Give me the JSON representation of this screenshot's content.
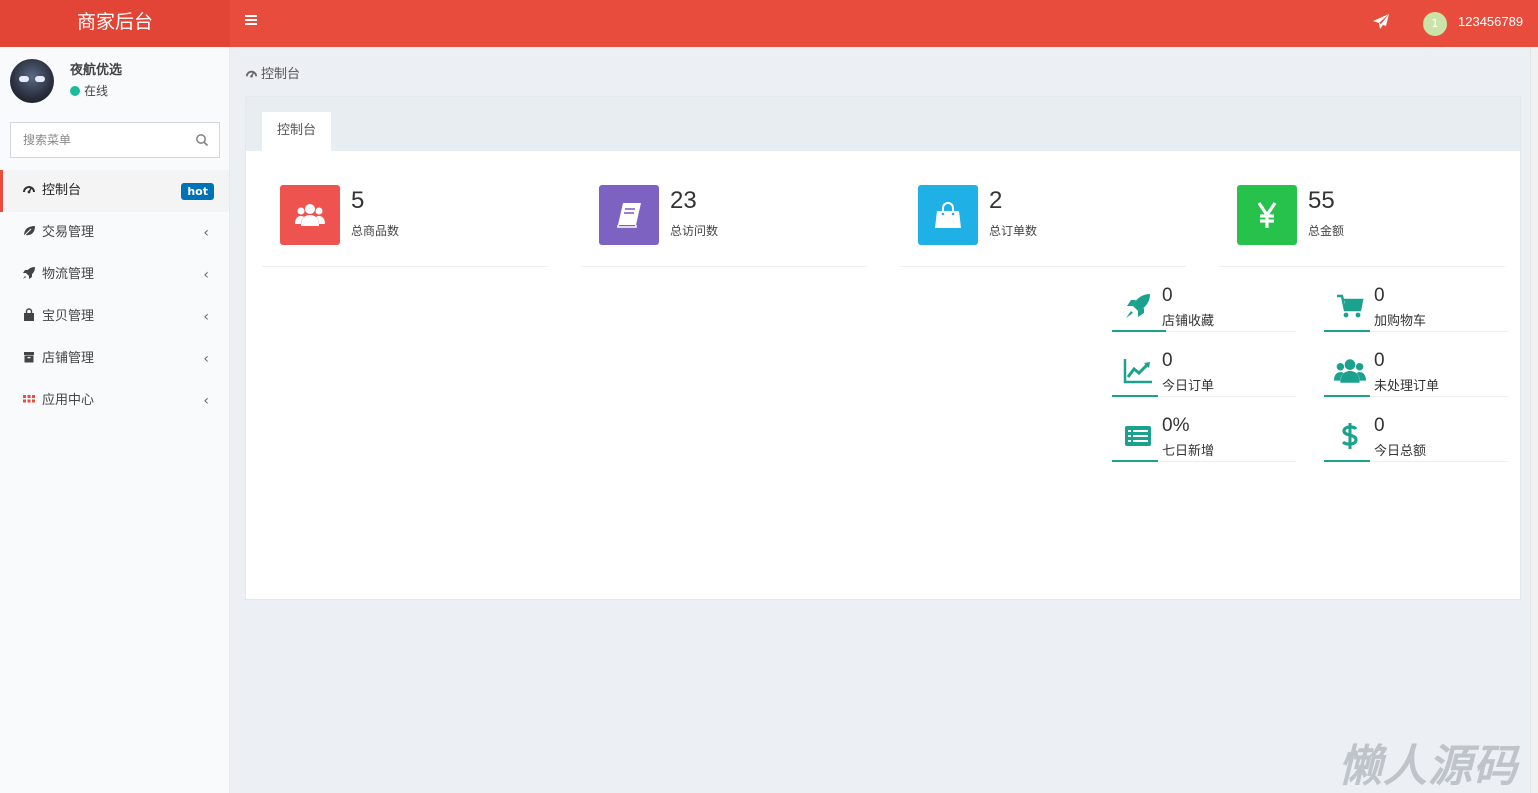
{
  "app": {
    "title": "商家后台",
    "user_id": "123456789",
    "avatar_badge": "1"
  },
  "sidebar": {
    "user_name": "夜航优选",
    "status": "在线",
    "search_placeholder": "搜索菜单",
    "items": [
      {
        "label": "控制台",
        "icon": "dashboard-icon",
        "badge": "hot"
      },
      {
        "label": "交易管理",
        "icon": "leaf-icon"
      },
      {
        "label": "物流管理",
        "icon": "rocket-icon"
      },
      {
        "label": "宝贝管理",
        "icon": "shopping-bag-icon"
      },
      {
        "label": "店铺管理",
        "icon": "archive-icon"
      },
      {
        "label": "应用中心",
        "icon": "grid-icon"
      }
    ],
    "chevron": "‹"
  },
  "breadcrumb": {
    "label": "控制台"
  },
  "tab": {
    "label": "控制台"
  },
  "stats": [
    {
      "value": "5",
      "label": "总商品数",
      "color": "#ef5350",
      "icon": "users-icon"
    },
    {
      "value": "23",
      "label": "总访问数",
      "color": "#7e62c1",
      "icon": "book-icon"
    },
    {
      "value": "2",
      "label": "总订单数",
      "color": "#1fb0e6",
      "icon": "shopping-bag-icon"
    },
    {
      "value": "55",
      "label": "总金额",
      "color": "#27c24c",
      "icon": "yen-icon"
    }
  ],
  "mini_stats": [
    {
      "value": "0",
      "label": "店铺收藏",
      "icon": "rocket-icon"
    },
    {
      "value": "0",
      "label": "加购物车",
      "icon": "cart-icon"
    },
    {
      "value": "0",
      "label": "今日订单",
      "icon": "line-chart-icon"
    },
    {
      "value": "0",
      "label": "未处理订单",
      "icon": "users-icon"
    },
    {
      "value": "0%",
      "label": "七日新增",
      "icon": "list-icon"
    },
    {
      "value": "0",
      "label": "今日总额",
      "icon": "dollar-icon"
    }
  ],
  "accent_color": "#e74c3c",
  "teal_color": "#1aa28e",
  "watermark": "懒人源码"
}
